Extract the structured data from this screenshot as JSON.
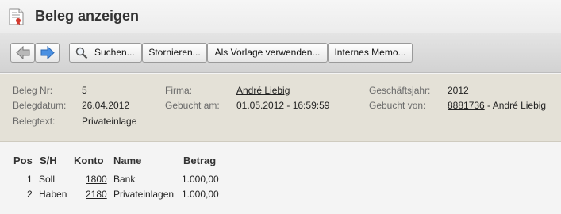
{
  "window": {
    "title": "Beleg anzeigen",
    "icon": "document-certificate-icon"
  },
  "toolbar": {
    "back_icon": "arrow-left-icon",
    "forward_icon": "arrow-right-icon",
    "search_label": "Suchen...",
    "cancel_label": "Stornieren...",
    "template_label": "Als Vorlage verwenden...",
    "memo_label": "Internes Memo..."
  },
  "header": {
    "beleg_nr_label": "Beleg Nr:",
    "beleg_nr": "5",
    "belegdatum_label": "Belegdatum:",
    "belegdatum": "26.04.2012",
    "belegtext_label": "Belegtext:",
    "belegtext": "Privateinlage",
    "firma_label": "Firma:",
    "firma": "André Liebig",
    "gebucht_am_label": "Gebucht am:",
    "gebucht_am": "01.05.2012 - 16:59:59",
    "geschaeftsjahr_label": "Geschäftsjahr:",
    "geschaeftsjahr": "2012",
    "gebucht_von_label": "Gebucht von:",
    "gebucht_von_id": "8881736",
    "gebucht_von_name": " - André Liebig"
  },
  "table": {
    "columns": [
      "Pos",
      "S/H",
      "Konto",
      "Name",
      "Betrag"
    ],
    "rows": [
      {
        "pos": "1",
        "sh": "Soll",
        "konto": "1800",
        "name": "Bank",
        "betrag": "1.000,00"
      },
      {
        "pos": "2",
        "sh": "Haben",
        "konto": "2180",
        "name": "Privateinlagen",
        "betrag": "1.000,00"
      }
    ]
  },
  "colors": {
    "header_bg": "#e4e1d7",
    "toolbar_bg": "#d9d9d9",
    "nav_arrow": "#3a7fd0"
  }
}
